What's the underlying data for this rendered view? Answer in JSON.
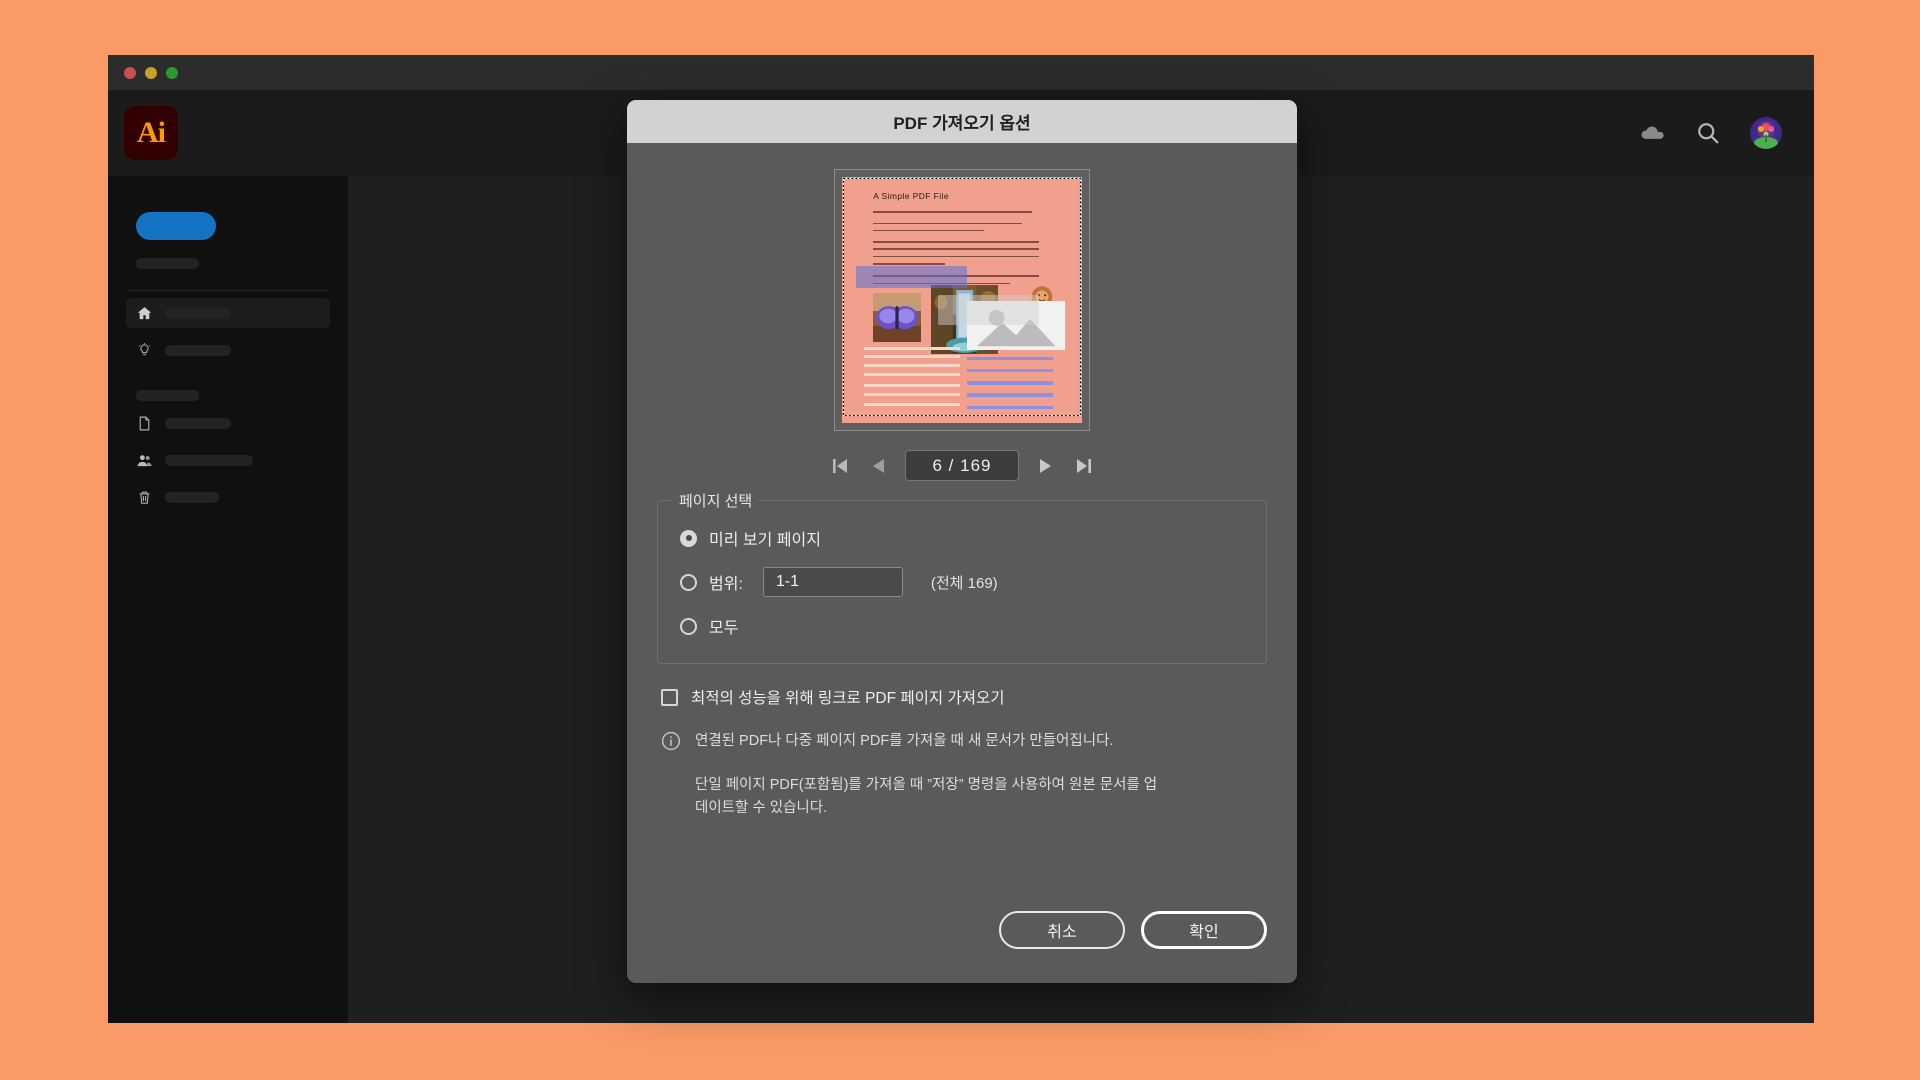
{
  "desktop": {
    "background": "#f99a67"
  },
  "app": {
    "name": "Adobe Illustrator",
    "logo_text": "Ai",
    "logo_bg": "#330000",
    "logo_fg": "#ff9a00",
    "accent": "#1473c4",
    "window_controls": [
      "close-red",
      "minimize-yellow",
      "zoom-green"
    ],
    "header_icons": [
      "cloud-icon",
      "search-icon",
      "avatar"
    ]
  },
  "sidebar": {
    "cta_label": "",
    "items": [
      {
        "icon": "home-icon",
        "label": "",
        "active": true
      },
      {
        "icon": "lightbulb-icon",
        "label": "",
        "active": false
      },
      {
        "icon": "document-icon",
        "label": "",
        "active": false
      },
      {
        "icon": "people-icon",
        "label": "",
        "active": false
      },
      {
        "icon": "trash-icon",
        "label": "",
        "active": false
      }
    ]
  },
  "dialog": {
    "title": "PDF 가져오기 옵션",
    "preview": {
      "page_title": "A Simple PDF File",
      "images": [
        "butterfly",
        "waterfall",
        "lion",
        "image-placeholder"
      ],
      "page_bg": "#f0a08c",
      "selection": "marching-ants"
    },
    "pager": {
      "first_label": "|◀",
      "prev_label": "◀",
      "value": "6 / 169",
      "next_label": "▶",
      "last_label": "▶|",
      "current_page": 6,
      "total_pages": 169
    },
    "page_select": {
      "legend": "페이지 선택",
      "options": [
        {
          "label": "미리 보기 페이지",
          "selected": true
        },
        {
          "label": "범위:",
          "selected": false
        },
        {
          "label": "모두",
          "selected": false
        }
      ],
      "range_value": "1-1",
      "range_total": "(전체 169)"
    },
    "link_import": {
      "label": "최적의 성능을 위해 링크로 PDF 페이지 가져오기",
      "checked": false
    },
    "info": {
      "icon": "info-icon",
      "line1": "연결된 PDF나 다중 페이지 PDF를 가져올 때 새 문서가 만들어집니다.",
      "line2": "단일 페이지 PDF(포함됨)를 가져올 때 ”저장” 명령을 사용하여 원본 문서를 업데이트할 수 있습니다."
    },
    "buttons": {
      "cancel": "취소",
      "ok": "확인"
    }
  }
}
